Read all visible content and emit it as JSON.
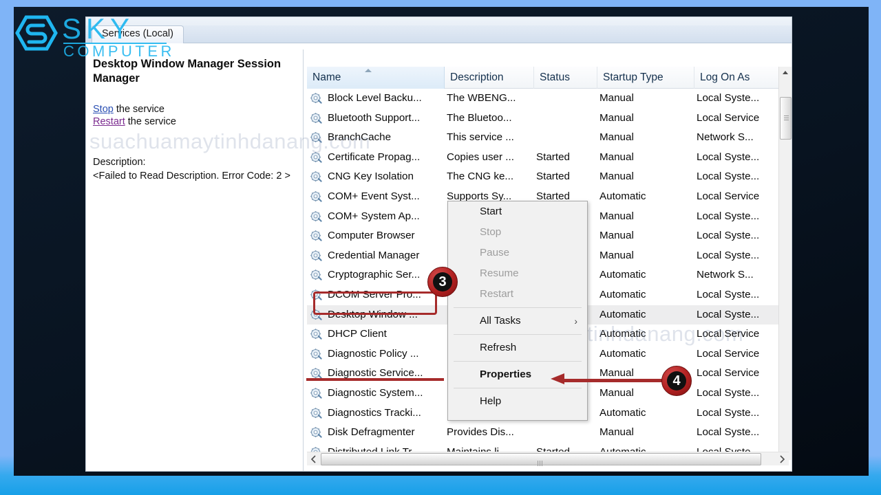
{
  "branding": {
    "logo_top": "SKY",
    "logo_bottom": "COMPUTER",
    "logo_color": "#1FB6F0"
  },
  "watermark": {
    "text": "suachuamaytinhdanang.com"
  },
  "window": {
    "tab_label": "Services (Local)"
  },
  "detail_pane": {
    "service_title": "Desktop Window Manager Session Manager",
    "stop_link": "Stop",
    "stop_suffix": " the service",
    "restart_link": "Restart",
    "restart_suffix": " the service",
    "description_label": "Description:",
    "description_value": "<Failed to Read Description. Error Code: 2 >"
  },
  "table": {
    "columns": [
      "Name",
      "Description",
      "Status",
      "Startup Type",
      "Log On As"
    ],
    "sorted_column": "Name",
    "rows": [
      {
        "name": "Block Level Backu...",
        "desc": "The WBENG...",
        "status": "",
        "startup": "Manual",
        "logon": "Local Syste..."
      },
      {
        "name": "Bluetooth Support...",
        "desc": "The Bluetoo...",
        "status": "",
        "startup": "Manual",
        "logon": "Local Service"
      },
      {
        "name": "BranchCache",
        "desc": "This service ...",
        "status": "",
        "startup": "Manual",
        "logon": "Network S..."
      },
      {
        "name": "Certificate Propag...",
        "desc": "Copies user ...",
        "status": "Started",
        "startup": "Manual",
        "logon": "Local Syste..."
      },
      {
        "name": "CNG Key Isolation",
        "desc": "The CNG ke...",
        "status": "Started",
        "startup": "Manual",
        "logon": "Local Syste..."
      },
      {
        "name": "COM+ Event Syst...",
        "desc": "Supports Sy...",
        "status": "Started",
        "startup": "Automatic",
        "logon": "Local Service"
      },
      {
        "name": "COM+ System Ap...",
        "desc": "",
        "status": "",
        "startup": "Manual",
        "logon": "Local Syste..."
      },
      {
        "name": "Computer Browser",
        "desc": "",
        "status": "",
        "startup": "Manual",
        "logon": "Local Syste..."
      },
      {
        "name": "Credential Manager",
        "desc": "",
        "status": "",
        "startup": "Manual",
        "logon": "Local Syste..."
      },
      {
        "name": "Cryptographic Ser...",
        "desc": "",
        "status": "",
        "startup": "Automatic",
        "logon": "Network S..."
      },
      {
        "name": "DCOM Server Pro...",
        "desc": "",
        "status": "",
        "startup": "Automatic",
        "logon": "Local Syste..."
      },
      {
        "name": "Desktop Window ...",
        "desc": "",
        "status": "",
        "startup": "Automatic",
        "logon": "Local Syste..."
      },
      {
        "name": "DHCP Client",
        "desc": "",
        "status": "",
        "startup": "Automatic",
        "logon": "Local Service"
      },
      {
        "name": "Diagnostic Policy ...",
        "desc": "",
        "status": "",
        "startup": "Automatic",
        "logon": "Local Service"
      },
      {
        "name": "Diagnostic Service...",
        "desc": "",
        "status": "",
        "startup": "Manual",
        "logon": "Local Service"
      },
      {
        "name": "Diagnostic System...",
        "desc": "",
        "status": "",
        "startup": "Manual",
        "logon": "Local Syste..."
      },
      {
        "name": "Diagnostics Tracki...",
        "desc": "",
        "status": "",
        "startup": "Automatic",
        "logon": "Local Syste..."
      },
      {
        "name": "Disk Defragmenter",
        "desc": "Provides Dis...",
        "status": "",
        "startup": "Manual",
        "logon": "Local Syste..."
      },
      {
        "name": "Distributed Link Tr...",
        "desc": "Maintains li...",
        "status": "Started",
        "startup": "Automatic",
        "logon": "Local Syste..."
      }
    ],
    "selected_row_index": 11
  },
  "context_menu": {
    "items": [
      {
        "label": "Start",
        "disabled": false,
        "bold": false,
        "submenu": ""
      },
      {
        "label": "Stop",
        "disabled": true,
        "bold": false,
        "submenu": ""
      },
      {
        "label": "Pause",
        "disabled": true,
        "bold": false,
        "submenu": ""
      },
      {
        "label": "Resume",
        "disabled": true,
        "bold": false,
        "submenu": ""
      },
      {
        "label": "Restart",
        "disabled": true,
        "bold": false,
        "submenu": ""
      },
      {
        "label": "All Tasks",
        "disabled": false,
        "bold": false,
        "submenu": "›"
      },
      {
        "label": "Refresh",
        "disabled": false,
        "bold": false,
        "submenu": ""
      },
      {
        "label": "Properties",
        "disabled": false,
        "bold": true,
        "submenu": ""
      },
      {
        "label": "Help",
        "disabled": false,
        "bold": false,
        "submenu": ""
      }
    ]
  },
  "annotations": {
    "step3": "3",
    "step4": "4",
    "marker_color": "#A62B2B"
  }
}
